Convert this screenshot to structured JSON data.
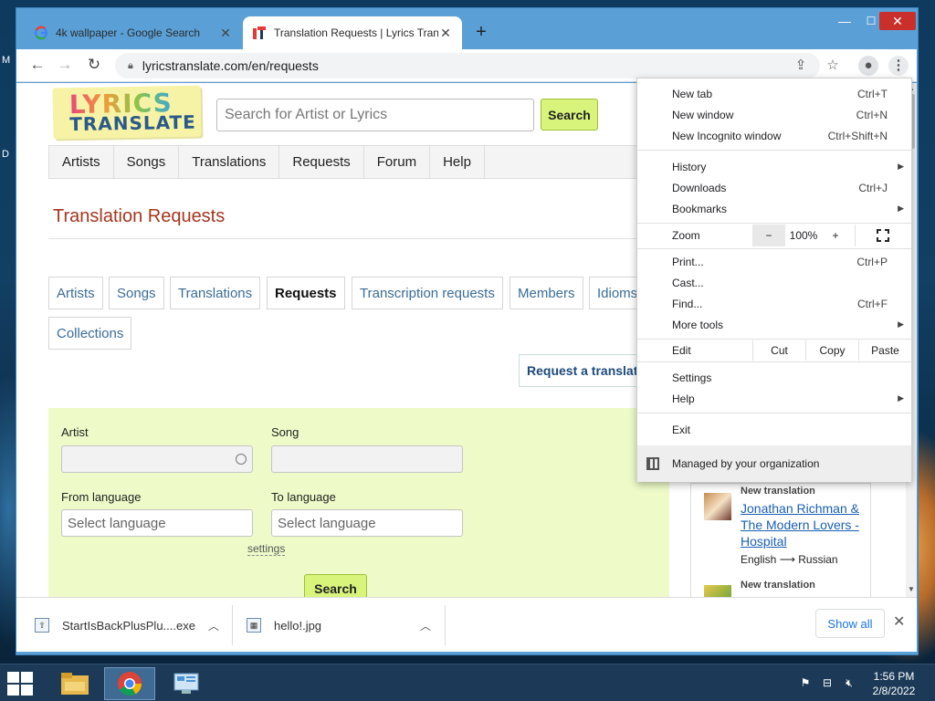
{
  "desktop": {
    "letters": [
      "M",
      "D"
    ]
  },
  "window": {
    "min": "—",
    "max": "☐",
    "close": "✕"
  },
  "tabs": [
    {
      "title": "4k wallpaper - Google Search",
      "close": "✕",
      "favicon": "google-icon"
    },
    {
      "title": "Translation Requests | Lyrics Tran",
      "close": "✕",
      "favicon": "lyricstranslate-icon"
    }
  ],
  "new_tab": "+",
  "toolbar": {
    "back": "←",
    "forward": "→",
    "reload": "↻",
    "url": "lyricstranslate.com/en/requests",
    "share": "⇪",
    "star": "☆",
    "profile": "●",
    "menu": "⋮"
  },
  "page": {
    "logo_top": "LYRICS",
    "logo_bottom": "TRANSLATE",
    "search_placeholder": "Search for Artist or Lyrics",
    "search_button": "Search",
    "nav": [
      "Artists",
      "Songs",
      "Translations",
      "Requests",
      "Forum",
      "Help"
    ],
    "title": "Translation Requests",
    "subtabs": [
      "Artists",
      "Songs",
      "Translations",
      "Requests",
      "Transcription requests",
      "Members",
      "Idioms",
      "Collections"
    ],
    "request_button": "Request a translation",
    "form": {
      "artist_label": "Artist",
      "song_label": "Song",
      "from_label": "From language",
      "to_label": "To language",
      "from_placeholder": "Select language",
      "to_placeholder": "Select language",
      "settings": "settings",
      "search": "Search"
    },
    "feed": [
      {
        "kind": "New translation",
        "song": "Jonathan Richman & The Modern Lovers - Hospital",
        "pair": "English ⟶ Russian"
      },
      {
        "kind": "New translation"
      }
    ]
  },
  "menu": {
    "new_tab": "New tab",
    "new_tab_sc": "Ctrl+T",
    "new_window": "New window",
    "new_window_sc": "Ctrl+N",
    "incognito": "New Incognito window",
    "incognito_sc": "Ctrl+Shift+N",
    "history": "History",
    "downloads": "Downloads",
    "downloads_sc": "Ctrl+J",
    "bookmarks": "Bookmarks",
    "zoom": "Zoom",
    "zoom_minus": "−",
    "zoom_value": "100%",
    "zoom_plus": "+",
    "print": "Print...",
    "print_sc": "Ctrl+P",
    "cast": "Cast...",
    "find": "Find...",
    "find_sc": "Ctrl+F",
    "more_tools": "More tools",
    "edit": "Edit",
    "cut": "Cut",
    "copy": "Copy",
    "paste": "Paste",
    "settings": "Settings",
    "help": "Help",
    "exit": "Exit",
    "managed": "Managed by your organization"
  },
  "downloads": [
    {
      "name": "StartIsBackPlusPlu....exe"
    },
    {
      "name": "hello!.jpg"
    }
  ],
  "show_all": "Show all",
  "taskbar": {
    "time": "1:56 PM",
    "date": "2/8/2022"
  }
}
